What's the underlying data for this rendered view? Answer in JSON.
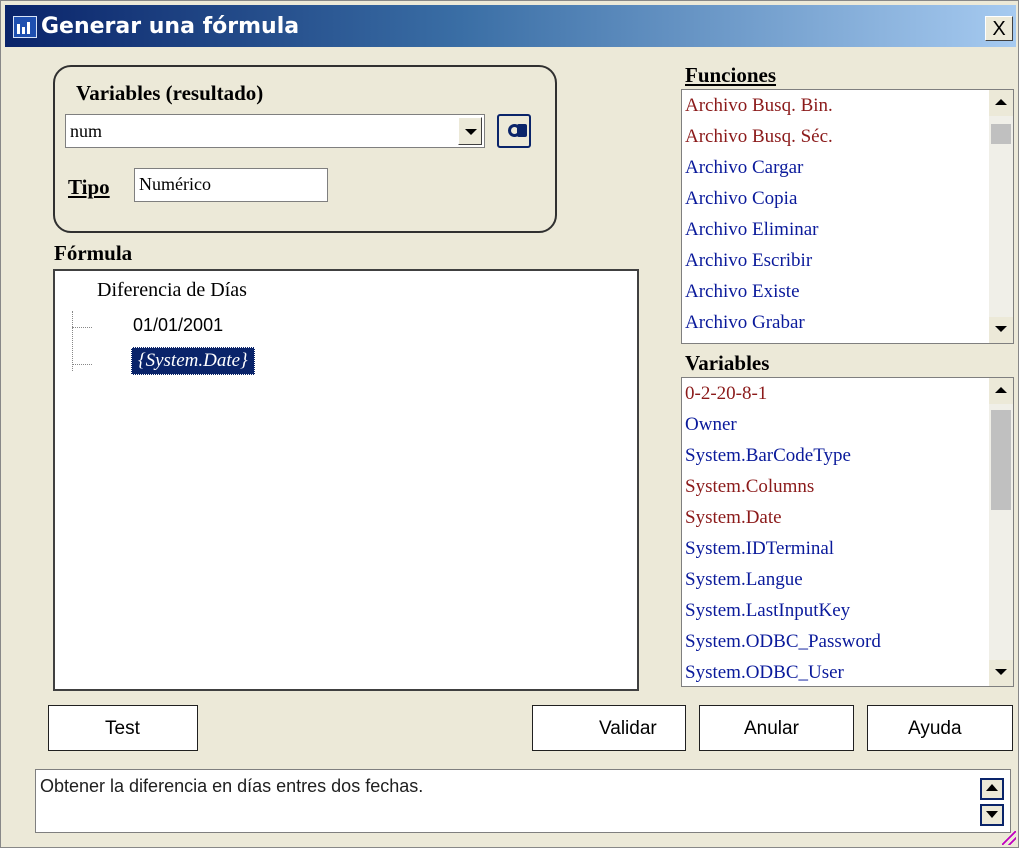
{
  "window": {
    "title": "Generar una fórmula",
    "close_label": "X"
  },
  "variables_result": {
    "label": "Variables (resultado)",
    "combo_value": "num",
    "tipo_label": "Tipo",
    "tipo_value": "Numérico"
  },
  "formula": {
    "label": "Fórmula",
    "root": "Diferencia de Días",
    "children": [
      "01/01/2001",
      "{System.Date}"
    ]
  },
  "funciones": {
    "label": "Funciones",
    "items": [
      {
        "text": "Archivo Busq. Bin.",
        "color": "red"
      },
      {
        "text": "Archivo Busq. Séc.",
        "color": "red"
      },
      {
        "text": "Archivo Cargar",
        "color": "blue"
      },
      {
        "text": "Archivo Copia",
        "color": "blue"
      },
      {
        "text": "Archivo Eliminar",
        "color": "blue"
      },
      {
        "text": "Archivo Escribir",
        "color": "blue"
      },
      {
        "text": "Archivo Existe",
        "color": "blue"
      },
      {
        "text": "Archivo Grabar",
        "color": "blue"
      }
    ]
  },
  "variables": {
    "label": "Variables",
    "items": [
      {
        "text": "0-2-20-8-1",
        "color": "red"
      },
      {
        "text": "Owner",
        "color": "blue"
      },
      {
        "text": "System.BarCodeType",
        "color": "blue"
      },
      {
        "text": "System.Columns",
        "color": "red"
      },
      {
        "text": "System.Date",
        "color": "red"
      },
      {
        "text": "System.IDTerminal",
        "color": "blue"
      },
      {
        "text": "System.Langue",
        "color": "blue"
      },
      {
        "text": "System.LastInputKey",
        "color": "blue"
      },
      {
        "text": "System.ODBC_Password",
        "color": "blue"
      },
      {
        "text": "System.ODBC_User",
        "color": "blue"
      }
    ]
  },
  "buttons": {
    "test": "Test",
    "validar": "Validar",
    "anular": "Anular",
    "ayuda": "Ayuda"
  },
  "status_text": "Obtener la diferencia en días entres dos fechas.",
  "colors": {
    "red": "#8b1a1a",
    "blue": "#0a1a9b",
    "title_start": "#0a246a",
    "title_end": "#a6caf0"
  }
}
